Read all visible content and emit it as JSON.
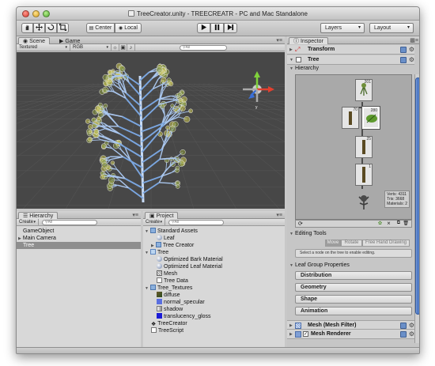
{
  "window": {
    "title": "TreeCreator.unity - TREECREATR - PC and Mac Standalone"
  },
  "toolbar": {
    "pivot_label": "Center",
    "space_label": "Local",
    "layers_label": "Layers",
    "layout_label": "Layout"
  },
  "scene_panel": {
    "tabs": [
      {
        "label": "Scene"
      },
      {
        "label": "Game"
      }
    ],
    "render_mode": "Textured",
    "color_mode": "RGB",
    "search_placeholder": "All"
  },
  "hierarchy_panel": {
    "tab_label": "Hierarchy",
    "create_label": "Create",
    "search_placeholder": "All",
    "items": [
      {
        "label": "GameObject"
      },
      {
        "label": "Main Camera"
      },
      {
        "label": "Tree"
      }
    ]
  },
  "project_panel": {
    "tab_label": "Project",
    "create_label": "Create",
    "search_placeholder": "All",
    "items": [
      {
        "label": "Standard Assets"
      },
      {
        "label": "Leaf"
      },
      {
        "label": "Tree Creator"
      },
      {
        "label": "Tree"
      },
      {
        "label": "Optimized Bark Material"
      },
      {
        "label": "Optimized Leaf Material"
      },
      {
        "label": "Mesh"
      },
      {
        "label": "Tree Data"
      },
      {
        "label": "Tree_Textures"
      },
      {
        "label": "diffuse"
      },
      {
        "label": "normal_specular"
      },
      {
        "label": "shadow"
      },
      {
        "label": "translucency_gloss"
      },
      {
        "label": "TreeCreator"
      },
      {
        "label": "TreeScript"
      }
    ]
  },
  "inspector": {
    "tab_label": "Inspector",
    "transform_label": "Transform",
    "tree_label": "Tree",
    "hierarchy_header": "Hierarchy",
    "nodes": [
      {
        "count": "201"
      },
      {
        "count": "70"
      },
      {
        "count": "280"
      },
      {
        "count": "25"
      },
      {
        "count": "1"
      }
    ],
    "stats": {
      "verts": "Verts: 4311",
      "tris": "Tris: 3668",
      "materials": "Materials: 2"
    },
    "editing_tools_header": "Editing Tools",
    "tool_buttons": [
      {
        "label": "Move"
      },
      {
        "label": "Rotate"
      },
      {
        "label": "Free Hand Drawing"
      }
    ],
    "hint": "Select a node on the tree to enable editing.",
    "leaf_group_header": "Leaf Group Properties",
    "sections": [
      {
        "label": "Distribution"
      },
      {
        "label": "Geometry"
      },
      {
        "label": "Shape"
      },
      {
        "label": "Animation"
      }
    ],
    "mesh_filter_label": "Mesh (Mesh Filter)",
    "mesh_renderer_label": "Mesh Renderer"
  },
  "colors": {
    "scene_bg": "#474747",
    "selection": "#8e8e8e",
    "scroll_blue": "#3f6ec1"
  }
}
